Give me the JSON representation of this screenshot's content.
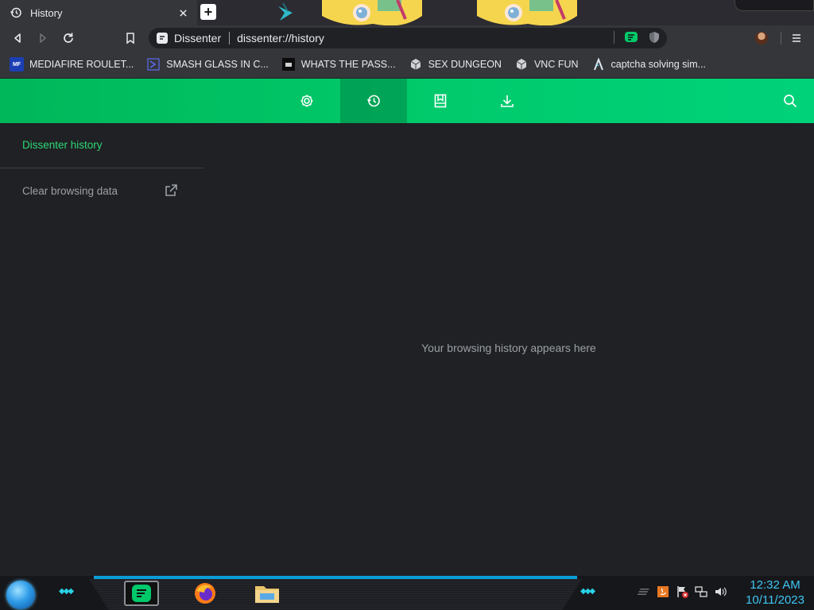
{
  "window": {
    "tab_title": "History",
    "new_tab_symbol": "+"
  },
  "toolbar": {
    "site_name": "Dissenter",
    "url": "dissenter://history"
  },
  "bookmarks": [
    {
      "label": "MEDIAFIRE ROULET...",
      "icon": "mediafire-icon",
      "icon_text": "MF"
    },
    {
      "label": "SMASH GLASS IN C...",
      "icon": "chevron-logo-icon"
    },
    {
      "label": "WHATS THE PASS...",
      "icon": "terminal-icon"
    },
    {
      "label": "SEX DUNGEON",
      "icon": "cube-icon"
    },
    {
      "label": "VNC FUN",
      "icon": "cube-icon"
    },
    {
      "label": "captcha solving sim...",
      "icon": "lambda-icon"
    }
  ],
  "header": {
    "nav": [
      "settings-icon",
      "history-icon",
      "bookmarks-icon",
      "downloads-icon"
    ],
    "active": "history-icon"
  },
  "sidebar": {
    "active_item": "Dissenter history",
    "clear_label": "Clear browsing data"
  },
  "main": {
    "empty_message": "Your browsing history appears here"
  },
  "taskbar": {
    "time": "12:32 AM",
    "date": "10/11/2023",
    "accent": "#3ec6f2"
  },
  "colors": {
    "brand_green": "#00c96a",
    "active_link": "#2bd874",
    "page_bg": "#202124"
  }
}
